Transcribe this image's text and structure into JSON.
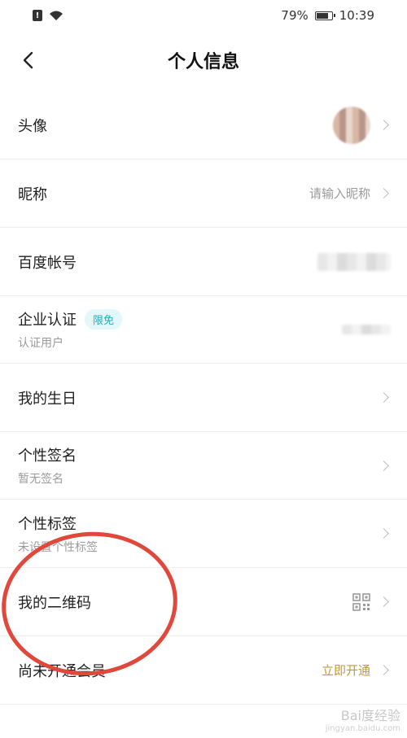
{
  "status_bar": {
    "battery_percent": "79%",
    "battery_level": 0.79,
    "time": "10:39"
  },
  "nav": {
    "title": "个人信息"
  },
  "rows": {
    "avatar": {
      "label": "头像"
    },
    "nickname": {
      "label": "昵称",
      "value": "请输入昵称"
    },
    "baidu_account": {
      "label": "百度帐号"
    },
    "enterprise": {
      "label": "企业认证",
      "badge": "限免",
      "sub": "认证用户"
    },
    "birthday": {
      "label": "我的生日"
    },
    "signature": {
      "label": "个性签名",
      "sub": "暂无签名"
    },
    "tags": {
      "label": "个性标签",
      "sub": "未设置个性标签"
    },
    "qrcode": {
      "label": "我的二维码"
    },
    "membership": {
      "label": "尚未开通会员",
      "value": "立即开通"
    }
  },
  "colors": {
    "accent": "#c29a33",
    "badge_text": "#27a9b8",
    "badge_bg": "#e4f7f9",
    "annotation": "#e0483c"
  },
  "watermark": {
    "main": "Bai度经验",
    "sub": "jingyan.baidu.com"
  }
}
